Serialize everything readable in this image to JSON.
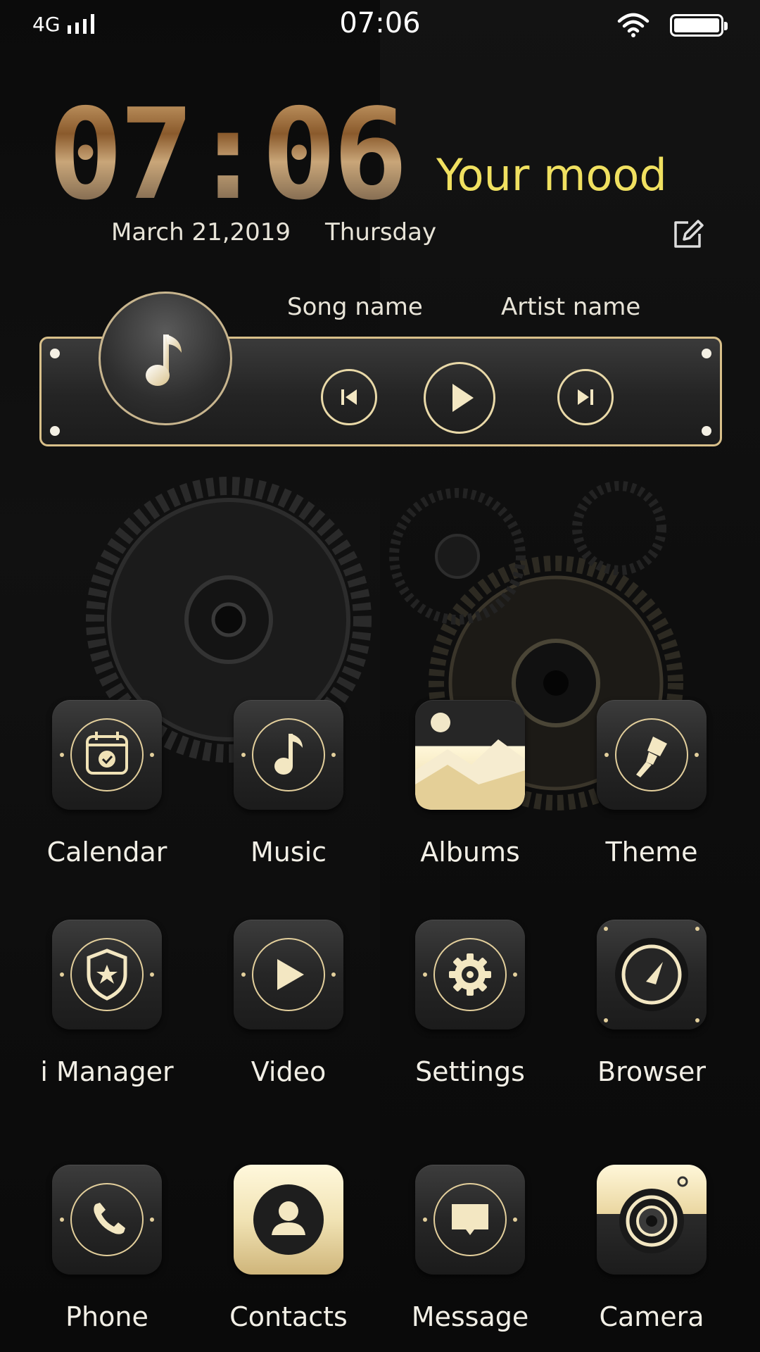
{
  "status_bar": {
    "network": "4G",
    "time": "07:06"
  },
  "clock_widget": {
    "time": "07:06",
    "date": "March 21,2019",
    "weekday": "Thursday",
    "mood": "Your mood"
  },
  "music_widget": {
    "song": "Song name",
    "artist": "Artist name"
  },
  "apps": [
    {
      "label": "Calendar",
      "icon": "calendar-icon"
    },
    {
      "label": "Music",
      "icon": "music-note-icon"
    },
    {
      "label": "Albums",
      "icon": "mountain-photo-icon"
    },
    {
      "label": "Theme",
      "icon": "paintbrush-icon"
    },
    {
      "label": "i Manager",
      "icon": "shield-star-icon"
    },
    {
      "label": "Video",
      "icon": "play-icon"
    },
    {
      "label": "Settings",
      "icon": "gear-icon"
    },
    {
      "label": "Browser",
      "icon": "compass-icon"
    },
    {
      "label": "Phone",
      "icon": "phone-icon"
    },
    {
      "label": "Contacts",
      "icon": "person-icon"
    },
    {
      "label": "Message",
      "icon": "message-icon"
    },
    {
      "label": "Camera",
      "icon": "camera-icon"
    }
  ],
  "colors": {
    "accent_gold": "#e3cf9c",
    "mood_yellow": "#f0e060"
  }
}
